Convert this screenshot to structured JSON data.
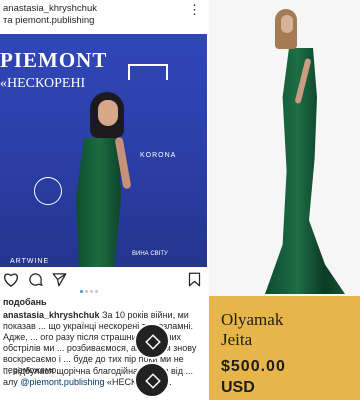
{
  "instagram": {
    "username": "anastasia_khryshchuk",
    "tagged_account": "piemont.publishing",
    "photo": {
      "backdrop_title": "PIEMONT",
      "backdrop_subtitle": "«НЕСКОРЕНІ",
      "sponsor_korona": "KORONA",
      "sponsor_bottom": "ARTWINE",
      "sponsor_vyna": "ВИНА СВІТУ"
    },
    "carousel": {
      "count": 4,
      "active_index": 0
    },
    "likes_label": "подобань",
    "caption": {
      "author": "anastasia_khryshchuk",
      "text": "За 10 років війни, ми показав ... що українці нескорені та незламні. Адже, ... ого разу після страшних ракетних обстрілів ми ... розбиваємося, але потім знову воскресаємо і ... буде до тих пір поки ми не переможемо.",
      "text_2": "... відбулася щорічна благодійна премія від ... алу",
      "mention": "@piemont.publishing",
      "text_3": "«НЕСКОРЕНІ»."
    }
  },
  "product": {
    "brand_line1": "Olyamak",
    "brand_line2": "Jeita",
    "price": "$500.00",
    "currency": "USD",
    "accent_color": "#e7b54a",
    "dress_color": "#0e4a2d"
  }
}
